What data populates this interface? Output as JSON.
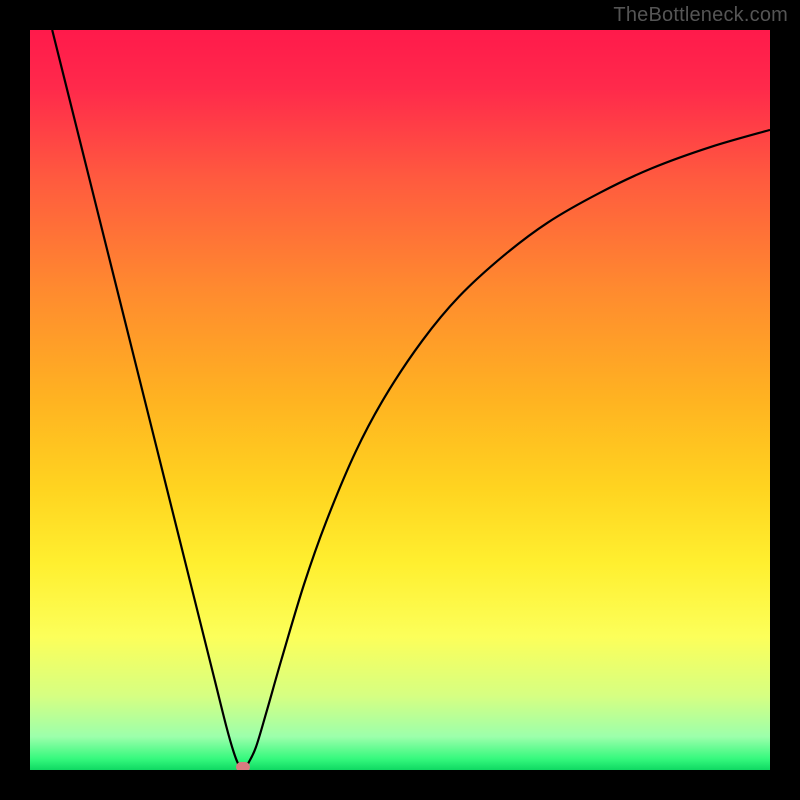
{
  "watermark": "TheBottleneck.com",
  "chart_data": {
    "type": "line",
    "title": "",
    "xlabel": "",
    "ylabel": "",
    "xlim": [
      0,
      100
    ],
    "ylim": [
      0,
      100
    ],
    "grid": false,
    "legend": false,
    "gradient_stops": [
      {
        "pos": 0,
        "color": "#ff1a4b"
      },
      {
        "pos": 0.08,
        "color": "#ff2a4b"
      },
      {
        "pos": 0.2,
        "color": "#ff5a3f"
      },
      {
        "pos": 0.35,
        "color": "#ff8a2f"
      },
      {
        "pos": 0.5,
        "color": "#ffb321"
      },
      {
        "pos": 0.62,
        "color": "#ffd420"
      },
      {
        "pos": 0.72,
        "color": "#ffef2f"
      },
      {
        "pos": 0.82,
        "color": "#fcff5a"
      },
      {
        "pos": 0.9,
        "color": "#d6ff82"
      },
      {
        "pos": 0.955,
        "color": "#9cffab"
      },
      {
        "pos": 0.985,
        "color": "#35f97d"
      },
      {
        "pos": 1.0,
        "color": "#0fd862"
      }
    ],
    "series": [
      {
        "name": "bottleneck-curve",
        "color": "#000000",
        "points": [
          {
            "x": 3.0,
            "y": 100.0
          },
          {
            "x": 5.0,
            "y": 92.0
          },
          {
            "x": 8.0,
            "y": 80.0
          },
          {
            "x": 11.0,
            "y": 68.0
          },
          {
            "x": 14.0,
            "y": 56.0
          },
          {
            "x": 17.0,
            "y": 44.0
          },
          {
            "x": 20.0,
            "y": 32.0
          },
          {
            "x": 23.0,
            "y": 20.0
          },
          {
            "x": 25.0,
            "y": 12.0
          },
          {
            "x": 26.5,
            "y": 6.0
          },
          {
            "x": 27.5,
            "y": 2.5
          },
          {
            "x": 28.2,
            "y": 0.7
          },
          {
            "x": 28.8,
            "y": 0.15
          },
          {
            "x": 29.3,
            "y": 0.6
          },
          {
            "x": 30.5,
            "y": 3.0
          },
          {
            "x": 32.0,
            "y": 8.0
          },
          {
            "x": 34.0,
            "y": 15.0
          },
          {
            "x": 37.0,
            "y": 25.0
          },
          {
            "x": 40.0,
            "y": 33.5
          },
          {
            "x": 44.0,
            "y": 43.0
          },
          {
            "x": 48.0,
            "y": 50.5
          },
          {
            "x": 53.0,
            "y": 58.0
          },
          {
            "x": 58.0,
            "y": 64.0
          },
          {
            "x": 64.0,
            "y": 69.5
          },
          {
            "x": 70.0,
            "y": 74.0
          },
          {
            "x": 77.0,
            "y": 78.0
          },
          {
            "x": 84.0,
            "y": 81.3
          },
          {
            "x": 92.0,
            "y": 84.2
          },
          {
            "x": 100.0,
            "y": 86.5
          }
        ]
      }
    ],
    "optimal_marker": {
      "x": 28.8,
      "y": 0.4,
      "color": "#d87b80"
    }
  }
}
